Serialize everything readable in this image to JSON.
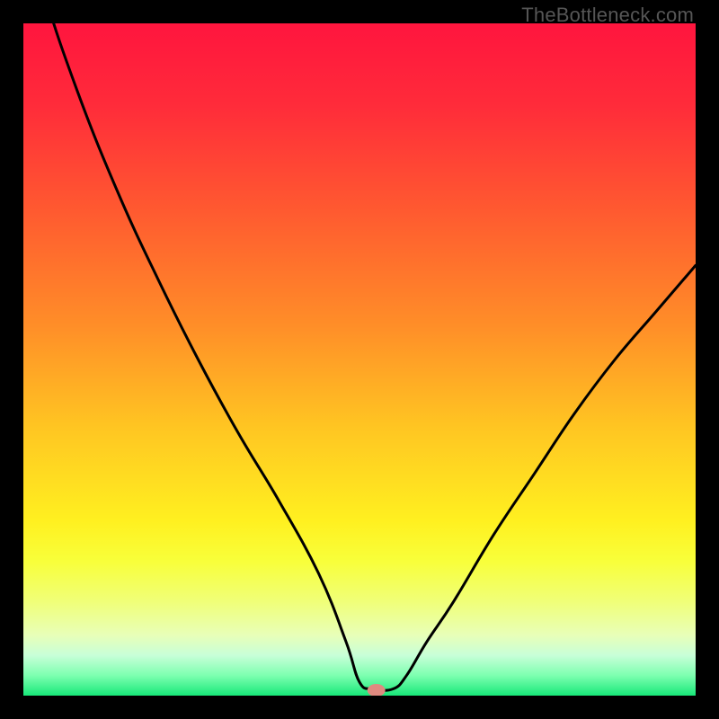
{
  "watermark": "TheBottleneck.com",
  "chart_data": {
    "type": "line",
    "title": "",
    "xlabel": "",
    "ylabel": "",
    "xlim": [
      0,
      100
    ],
    "ylim": [
      0,
      100
    ],
    "marker": {
      "x": 52.5,
      "y": 0.8
    },
    "series": [
      {
        "name": "bottleneck_curve",
        "x": [
          0,
          3,
          8,
          14,
          20,
          26,
          32,
          38,
          44,
          48,
          50,
          52,
          55,
          57,
          60,
          64,
          70,
          76,
          82,
          88,
          94,
          100
        ],
        "y": [
          118,
          105,
          90,
          75,
          62,
          50,
          39,
          29,
          18,
          8,
          2,
          1,
          1,
          3,
          8,
          14,
          24,
          33,
          42,
          50,
          57,
          64
        ]
      }
    ],
    "gradient_stops": [
      {
        "pct": 0,
        "color": "#ff153e"
      },
      {
        "pct": 12,
        "color": "#ff2b3a"
      },
      {
        "pct": 28,
        "color": "#ff5a30"
      },
      {
        "pct": 45,
        "color": "#ff8e28"
      },
      {
        "pct": 60,
        "color": "#ffc522"
      },
      {
        "pct": 74,
        "color": "#fff020"
      },
      {
        "pct": 80,
        "color": "#f8ff3a"
      },
      {
        "pct": 86,
        "color": "#f0ff78"
      },
      {
        "pct": 91,
        "color": "#e8ffb8"
      },
      {
        "pct": 94,
        "color": "#c8ffd8"
      },
      {
        "pct": 97,
        "color": "#7dffb0"
      },
      {
        "pct": 100,
        "color": "#18e879"
      }
    ]
  }
}
